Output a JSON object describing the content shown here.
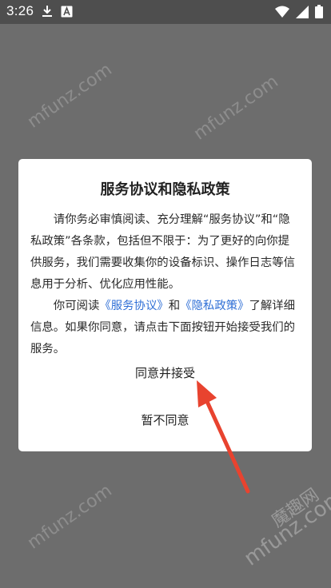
{
  "status_bar": {
    "time": "3:26",
    "icons": [
      "download-icon",
      "font-icon",
      "wifi-icon",
      "signal-icon",
      "battery-icon"
    ]
  },
  "dialog": {
    "title": "服务协议和隐私政策",
    "paragraph1": "请你务必审慎阅读、充分理解“服务协议”和“隐私政策”各条款，包括但不限于：为了更好的向你提供服务，我们需要收集你的设备标识、操作日志等信息用于分析、优化应用性能。",
    "p2_prefix": "你可阅读",
    "link_service": "《服务协议》",
    "p2_and": "和",
    "link_privacy": "《隐私政策》",
    "p2_suffix": "了解详细信息。如果你同意，请点击下面按钮开始接受我们的服务。",
    "accept_label": "同意并接受",
    "decline_label": "暂不同意"
  },
  "watermarks": {
    "domain": "mfunz.com",
    "site_name": "魔趣网"
  },
  "colors": {
    "link": "#2f6fd6",
    "arrow": "#e8432f",
    "overlay": "#6d6d6d"
  }
}
